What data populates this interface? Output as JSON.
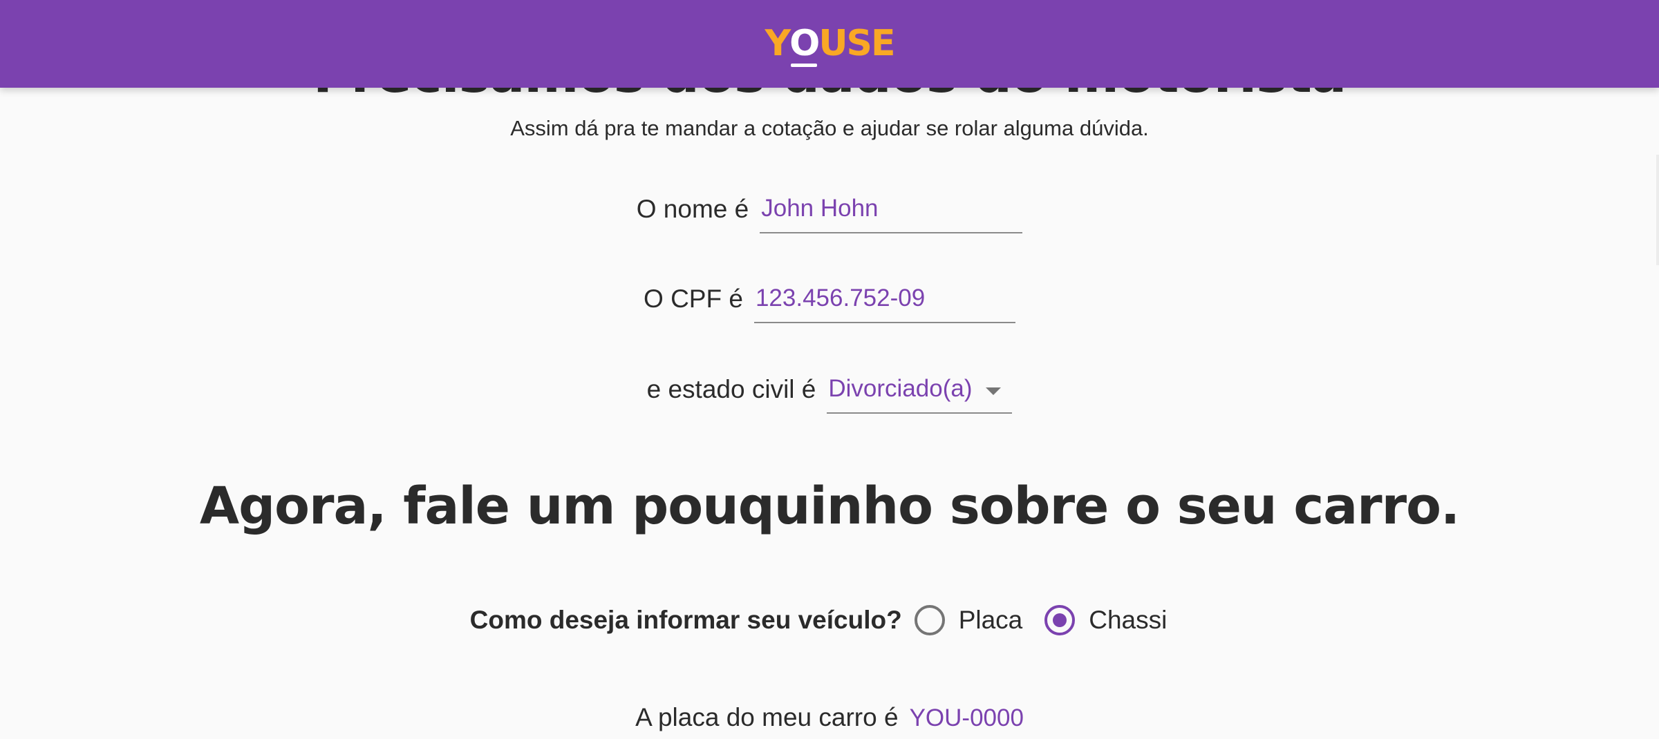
{
  "brand": {
    "logo_text": "YOUSE",
    "logo_parts": [
      "Y",
      "O",
      "USE"
    ],
    "header_color": "#7b42af",
    "logo_color": "#f9a825",
    "accent_color": "#7b42af"
  },
  "driver_section": {
    "heading": "Precisamos dos dados do motorista",
    "subtitle": "Assim dá pra te mandar a cotação e ajudar se rolar alguma dúvida.",
    "name": {
      "label": "O nome é",
      "value": "John Hohn"
    },
    "cpf": {
      "label": "O CPF é",
      "value": "123.456.752-09"
    },
    "marital_status": {
      "label": "e estado civil é",
      "selected": "Divorciado(a)",
      "icon": "chevron-down-icon"
    }
  },
  "car_section": {
    "heading": "Agora, fale um pouquinho sobre o seu carro.",
    "vehicle_question": "Como deseja informar seu veículo?",
    "options": [
      {
        "label": "Placa",
        "checked": false
      },
      {
        "label": "Chassi",
        "checked": true
      }
    ],
    "plate": {
      "label": "A placa do meu carro é",
      "value": "YOU-0000"
    }
  }
}
